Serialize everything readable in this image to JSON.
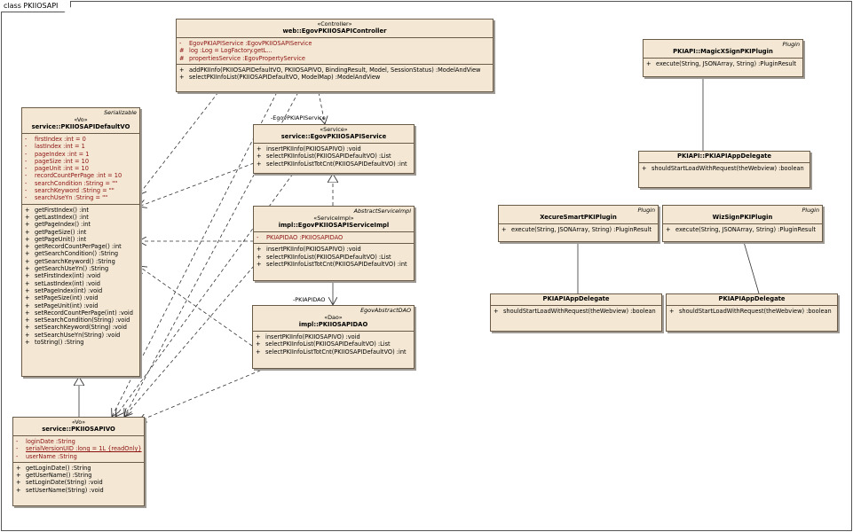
{
  "frame_title": "class PKIIOSAPI",
  "connector_labels": {
    "service": "-EgovPKIAPIService",
    "dao": "-PKIAPIDAO"
  },
  "boxes": {
    "controller": {
      "tag": "",
      "stereotype": "«Controller»",
      "name": "web::EgovPKIIOSAPIController",
      "attrs": [
        {
          "s": "-",
          "t": "EgovPKIAPIService  :EgovPKIIOSAPIService"
        },
        {
          "s": "#",
          "t": "log  :Log = LogFactory.getL..."
        },
        {
          "s": "#",
          "t": "propertiesService  :EgovPropertyService"
        }
      ],
      "ops": [
        {
          "s": "+",
          "t": "addPKIInfo(PKIIOSAPIDefaultVO, PKIIOSAPIVO, BindingResult, Model, SessionStatus)  :ModelAndView"
        },
        {
          "s": "+",
          "t": "selectPKIInfoList(PKIIOSAPIDefaultVO, ModelMap)  :ModelAndView"
        }
      ]
    },
    "defaultvo": {
      "tag": "Serializable",
      "stereotype": "«Vo»",
      "name": "service::PKIIOSAPIDefaultVO",
      "attrs": [
        {
          "s": "-",
          "t": "firstIndex  :int = 0"
        },
        {
          "s": "-",
          "t": "lastIndex  :int = 1"
        },
        {
          "s": "-",
          "t": "pageIndex  :int = 1"
        },
        {
          "s": "-",
          "t": "pageSize  :int = 10"
        },
        {
          "s": "-",
          "t": "pageUnit  :int = 10"
        },
        {
          "s": "-",
          "t": "recordCountPerPage  :int = 10"
        },
        {
          "s": "-",
          "t": "searchCondition  :String = \"\""
        },
        {
          "s": "-",
          "t": "searchKeyword  :String = \"\""
        },
        {
          "s": "-",
          "t": "searchUseYn  :String = \"\""
        }
      ],
      "ops": [
        {
          "s": "+",
          "t": "getFirstIndex()  :int"
        },
        {
          "s": "+",
          "t": "getLastIndex()  :int"
        },
        {
          "s": "+",
          "t": "getPageIndex()  :int"
        },
        {
          "s": "+",
          "t": "getPageSize()  :int"
        },
        {
          "s": "+",
          "t": "getPageUnit()  :int"
        },
        {
          "s": "+",
          "t": "getRecordCountPerPage()  :int"
        },
        {
          "s": "+",
          "t": "getSearchCondition()  :String"
        },
        {
          "s": "+",
          "t": "getSearchKeyword()  :String"
        },
        {
          "s": "+",
          "t": "getSearchUseYn()  :String"
        },
        {
          "s": "+",
          "t": "setFirstIndex(int)  :void"
        },
        {
          "s": "+",
          "t": "setLastIndex(int)  :void"
        },
        {
          "s": "+",
          "t": "setPageIndex(int)  :void"
        },
        {
          "s": "+",
          "t": "setPageSize(int)  :void"
        },
        {
          "s": "+",
          "t": "setPageUnit(int)  :void"
        },
        {
          "s": "+",
          "t": "setRecordCountPerPage(int)  :void"
        },
        {
          "s": "+",
          "t": "setSearchCondition(String)  :void"
        },
        {
          "s": "+",
          "t": "setSearchKeyword(String)  :void"
        },
        {
          "s": "+",
          "t": "setSearchUseYn(String)  :void"
        },
        {
          "s": "+",
          "t": "toString()  :String"
        }
      ]
    },
    "apivo": {
      "tag": "",
      "stereotype": "«Vo»",
      "name": "service::PKIIOSAPIVO",
      "attrs": [
        {
          "s": "-",
          "t": "loginDate  :String"
        },
        {
          "s": "-",
          "t": "serialVersionUID  :long = 1L {readOnly}",
          "cls": "red ul"
        },
        {
          "s": "-",
          "t": "userName  :String"
        }
      ],
      "ops": [
        {
          "s": "+",
          "t": "getLoginDate()  :String"
        },
        {
          "s": "+",
          "t": "getUserName()  :String"
        },
        {
          "s": "+",
          "t": "setLoginDate(String)  :void"
        },
        {
          "s": "+",
          "t": "setUserName(String)  :void"
        }
      ]
    },
    "service": {
      "tag": "",
      "stereotype": "«Service»",
      "name": "service::EgovPKIIOSAPIService",
      "ops": [
        {
          "s": "+",
          "t": "insertPKIInfo(PKIIOSAPIVO)  :void"
        },
        {
          "s": "+",
          "t": "selectPKIInfoList(PKIIOSAPIDefaultVO)  :List"
        },
        {
          "s": "+",
          "t": "selectPKIInfoListTotCnt(PKIIOSAPIDefaultVO)  :int"
        }
      ]
    },
    "serviceimpl": {
      "tag": "AbstractServiceImpl",
      "stereotype": "«ServiceImpl»",
      "name": "impl::EgovPKIIOSAPIServiceImpl",
      "attrs": [
        {
          "s": "-",
          "t": "PKIAPIDAO  :PKIIOSAPIDAO"
        }
      ],
      "ops": [
        {
          "s": "+",
          "t": "insertPKIInfo(PKIIOSAPIVO)  :void"
        },
        {
          "s": "+",
          "t": "selectPKIInfoList(PKIIOSAPIDefaultVO)  :List"
        },
        {
          "s": "+",
          "t": "selectPKIInfoListTotCnt(PKIIOSAPIDefaultVO)  :int"
        }
      ]
    },
    "dao": {
      "tag": "EgovAbstractDAO",
      "stereotype": "«Dao»",
      "name": "impl::PKIIOSAPIDAO",
      "ops": [
        {
          "s": "+",
          "t": "insertPKIInfo(PKIIOSAPIVO)  :void"
        },
        {
          "s": "+",
          "t": "selectPKIInfoList(PKIIOSAPIDefaultVO)  :List"
        },
        {
          "s": "+",
          "t": "selectPKIInfoListTotCnt(PKIIOSAPIDefaultVO)  :int"
        }
      ]
    },
    "magicx": {
      "tag": "Plugin",
      "stereotype": "",
      "name": "PKIAPI::MagicXSignPKIPlugin",
      "ops": [
        {
          "s": "+",
          "t": "execute(String, JSONArray, String)  :PluginResult"
        }
      ]
    },
    "delegate_top": {
      "tag": "",
      "stereotype": "",
      "name": "PKIAPI::PKIAPIAppDelegate",
      "ops": [
        {
          "s": "+",
          "t": "shouldStartLoadWithRequest(theWebview)  :boolean"
        }
      ]
    },
    "xecure": {
      "tag": "Plugin",
      "stereotype": "",
      "name": "XecureSmartPKIPlugin",
      "ops": [
        {
          "s": "+",
          "t": "execute(String, JSONArray, String)  :PluginResult"
        }
      ]
    },
    "wizsign": {
      "tag": "Plugin",
      "stereotype": "",
      "name": "WizSignPKIPlugin",
      "ops": [
        {
          "s": "+",
          "t": "execute(String, JSONArray, String)  :PluginResult"
        }
      ]
    },
    "delegate_left": {
      "tag": "",
      "stereotype": "",
      "name": "PKIAPIAppDelegate",
      "ops": [
        {
          "s": "+",
          "t": "shouldStartLoadWithRequest(theWebview)  :boolean"
        }
      ]
    },
    "delegate_right": {
      "tag": "",
      "stereotype": "",
      "name": "PKIAPIAppDelegate",
      "ops": [
        {
          "s": "+",
          "t": "shouldStartLoadWithRequest(theWebview)  :boolean"
        }
      ]
    }
  }
}
